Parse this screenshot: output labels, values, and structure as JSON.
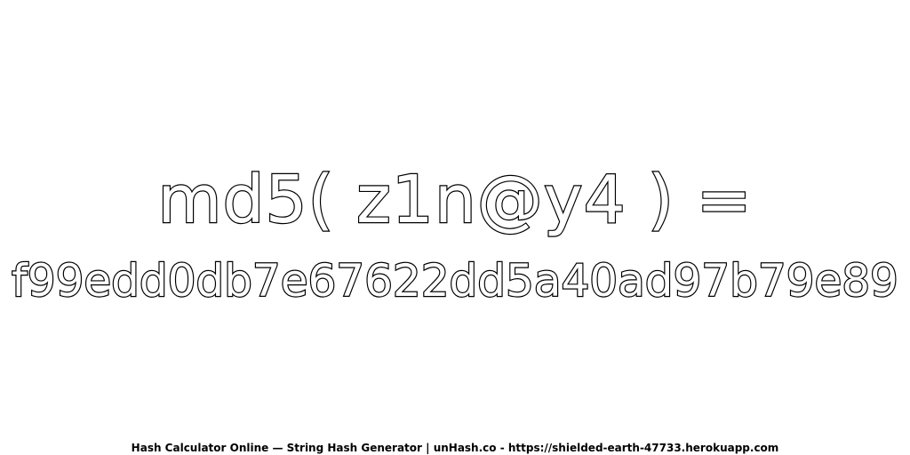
{
  "expression": "md5( z1n@y4 ) =",
  "hash": "f99edd0db7e67622dd5a40ad97b79e89",
  "footer": "Hash Calculator Online — String Hash Generator | unHash.co - https://shielded-earth-47733.herokuapp.com",
  "colors": {
    "background": "#ffffff",
    "text_fill": "#ffffff",
    "text_stroke": "#000000"
  }
}
